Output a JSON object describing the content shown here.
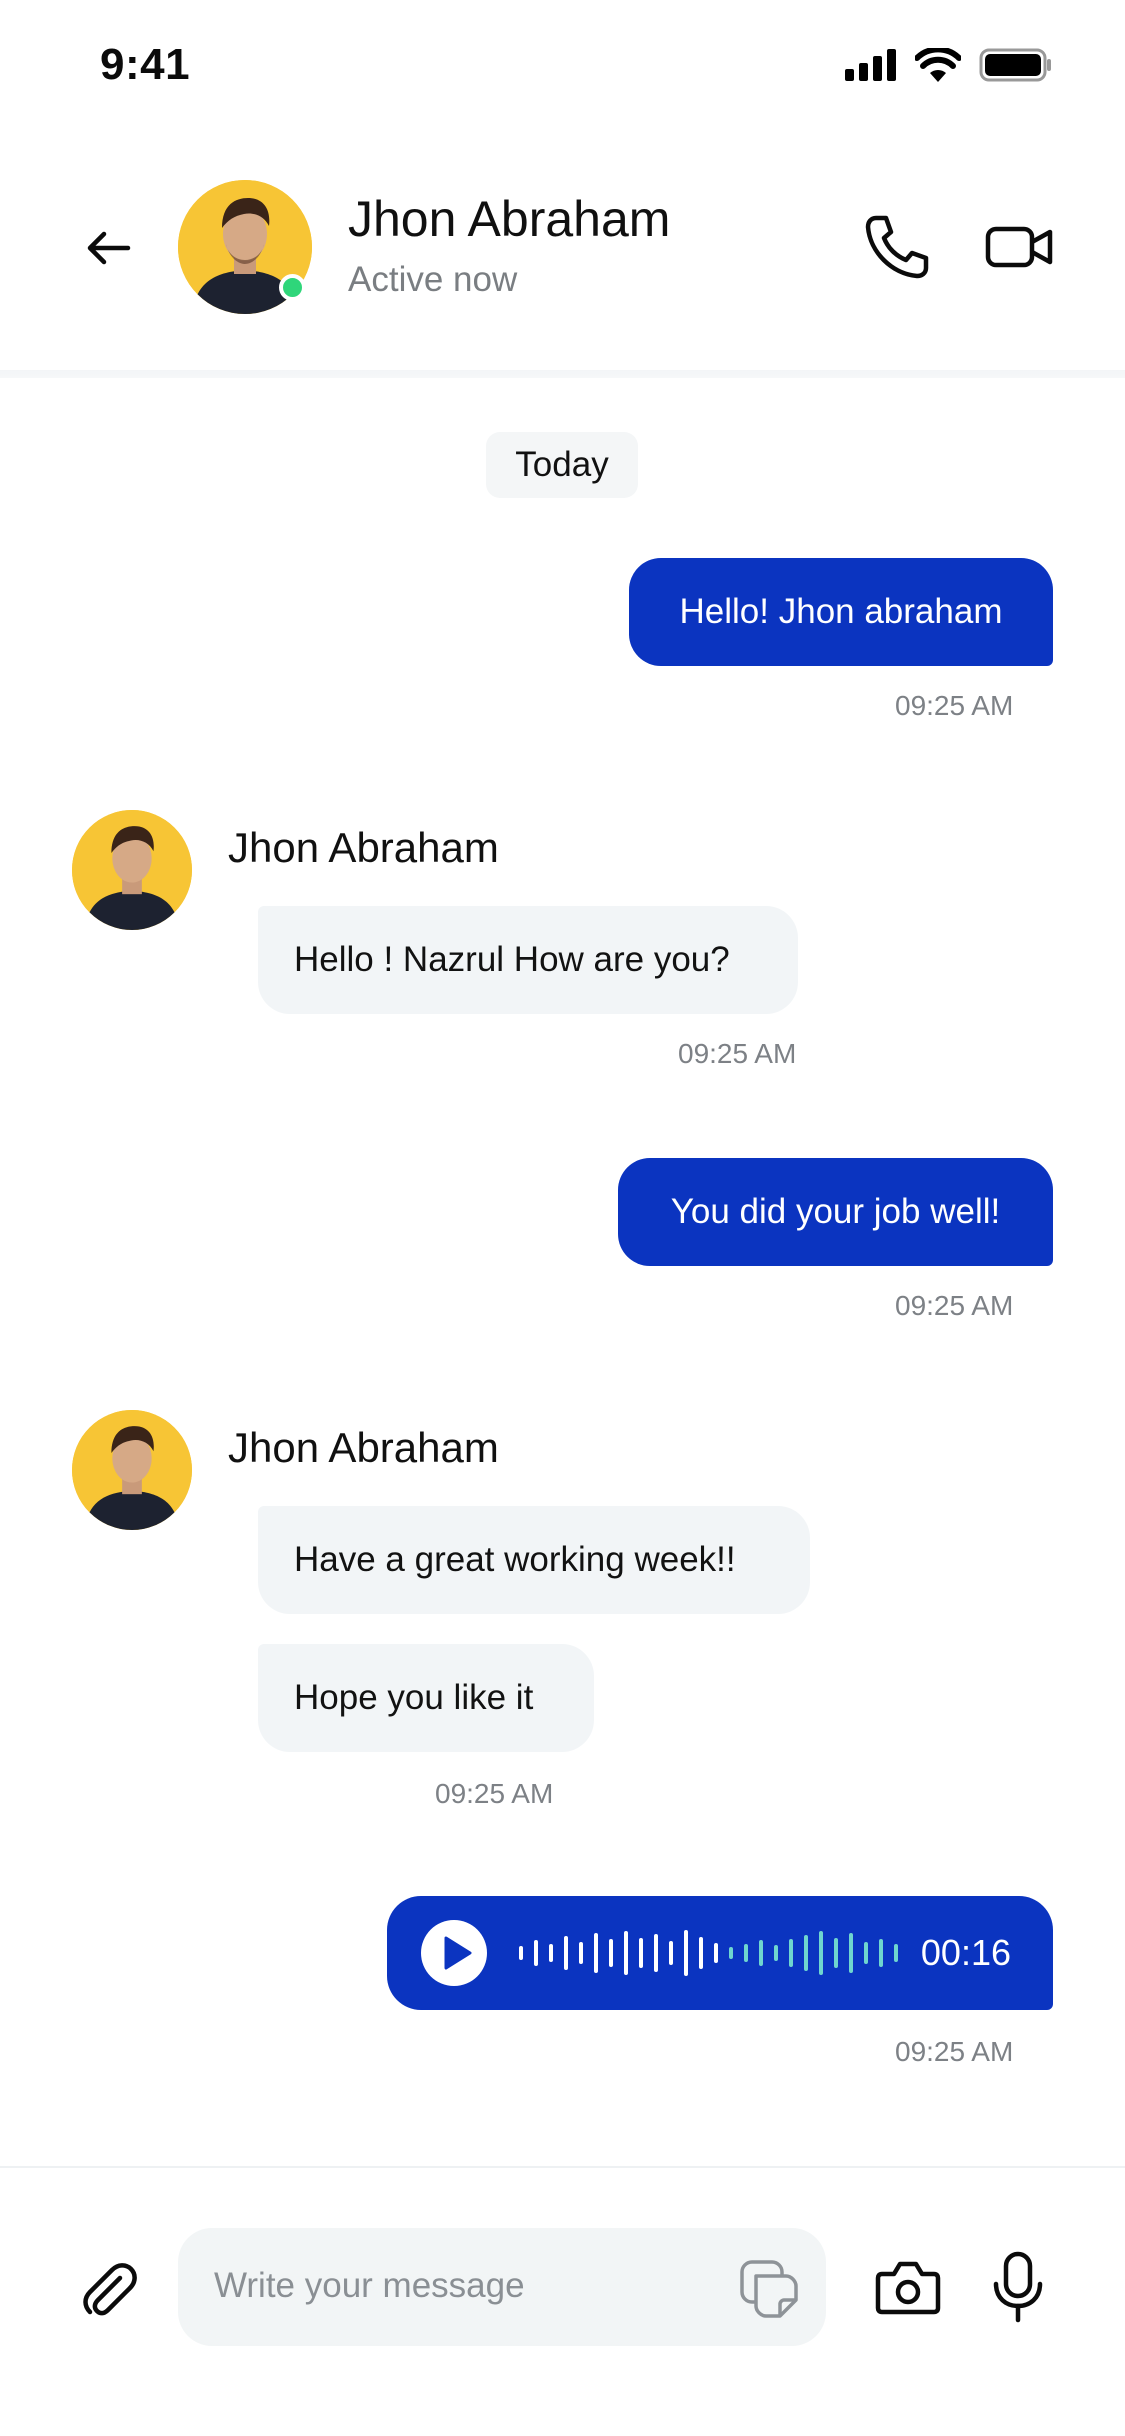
{
  "status_bar": {
    "time": "9:41"
  },
  "header": {
    "contact_name": "Jhon Abraham",
    "contact_status": "Active now",
    "online_color": "#2fd67a",
    "icons": [
      "back-arrow-icon",
      "phone-icon",
      "video-camera-icon"
    ]
  },
  "chat": {
    "date_label": "Today",
    "messages": [
      {
        "direction": "out",
        "text": "Hello! Jhon abraham",
        "time": "09:25 AM"
      },
      {
        "direction": "in",
        "sender": "Jhon Abraham",
        "text": "Hello ! Nazrul How are you?",
        "time": "09:25 AM"
      },
      {
        "direction": "out",
        "text": "You did your job well!",
        "time": "09:25 AM"
      },
      {
        "direction": "in",
        "sender": "Jhon Abraham",
        "texts": [
          "Have a great working week!!",
          "Hope you like it"
        ],
        "time": "09:25 AM"
      },
      {
        "direction": "out",
        "type": "voice",
        "duration": "00:16",
        "time": "09:25 AM",
        "played_fraction": 0.55
      }
    ],
    "colors": {
      "outgoing_bubble": "#0b34c0",
      "incoming_bubble": "#f2f5f7",
      "accent_avatar": "#f7c535"
    }
  },
  "composer": {
    "placeholder": "Write your message",
    "icons": [
      "paperclip-icon",
      "sticker-icon",
      "camera-icon",
      "microphone-icon"
    ]
  }
}
